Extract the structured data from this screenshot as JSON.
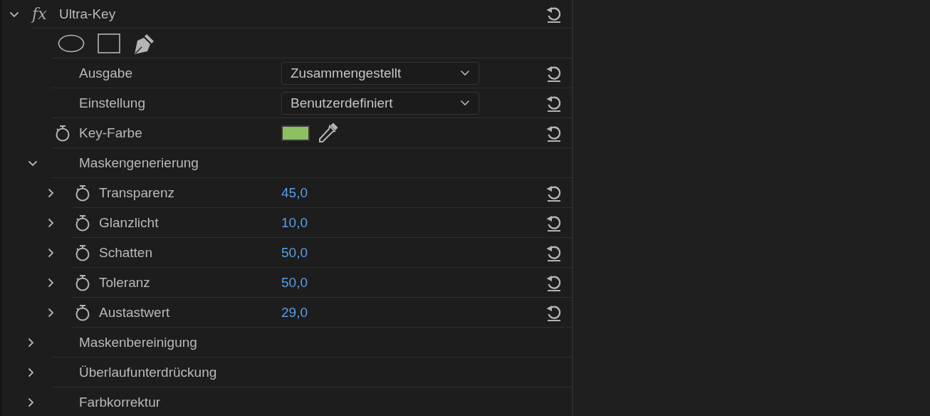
{
  "effect": {
    "icon_text": "fx",
    "name": "Ultra-Key",
    "expanded": true
  },
  "properties": [
    {
      "kind": "dropdown",
      "label": "Ausgabe",
      "value": "Zusammengestellt"
    },
    {
      "kind": "dropdown",
      "label": "Einstellung",
      "value": "Benutzerdefiniert"
    },
    {
      "kind": "color",
      "label": "Key-Farbe",
      "color": "#8cc063"
    },
    {
      "kind": "group",
      "label": "Maskengenerierung",
      "expanded": true,
      "children": [
        {
          "kind": "number",
          "label": "Transparenz",
          "value": "45,0",
          "expanded": false
        },
        {
          "kind": "number",
          "label": "Glanzlicht",
          "value": "10,0",
          "expanded": false
        },
        {
          "kind": "number",
          "label": "Schatten",
          "value": "50,0",
          "expanded": false
        },
        {
          "kind": "number",
          "label": "Toleranz",
          "value": "50,0",
          "expanded": false
        },
        {
          "kind": "number",
          "label": "Austastwert",
          "value": "29,0",
          "expanded": false
        }
      ]
    },
    {
      "kind": "group",
      "label": "Maskenbereinigung",
      "expanded": false
    },
    {
      "kind": "group",
      "label": "Überlaufunterdrückung",
      "expanded": false
    },
    {
      "kind": "group",
      "label": "Farbkorrektur",
      "expanded": false
    }
  ]
}
